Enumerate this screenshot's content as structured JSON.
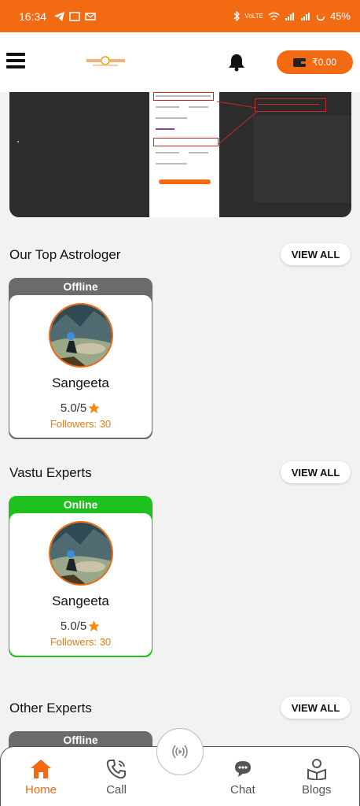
{
  "status_bar": {
    "time": "16:34",
    "battery": "45%",
    "network_label": "VoLTE"
  },
  "header": {
    "logo_alt": "logo",
    "wallet_amount": "₹0.00"
  },
  "sections": [
    {
      "title": "Our Top Astrologer",
      "view_all": "VIEW ALL",
      "card": {
        "status": "Offline",
        "name": "Sangeeta",
        "rating": "5.0/5",
        "followers": "Followers: 30"
      }
    },
    {
      "title": "Vastu Experts",
      "view_all": "VIEW ALL",
      "card": {
        "status": "Online",
        "name": "Sangeeta",
        "rating": "5.0/5",
        "followers": "Followers: 30"
      }
    },
    {
      "title": "Other Experts",
      "view_all": "VIEW ALL",
      "card": {
        "status": "Offline"
      }
    }
  ],
  "bottom_nav": {
    "items": [
      {
        "label": "Home",
        "icon": "home-icon"
      },
      {
        "label": "Call",
        "icon": "phone-icon"
      },
      {
        "label": "Chat",
        "icon": "chat-icon"
      },
      {
        "label": "Blogs",
        "icon": "blogs-icon"
      }
    ],
    "live_icon": "live-broadcast-icon"
  },
  "colors": {
    "brand": "#f26a12",
    "online": "#1fc11f",
    "offline": "#6b6b6b",
    "accent_text": "#e07b18"
  }
}
